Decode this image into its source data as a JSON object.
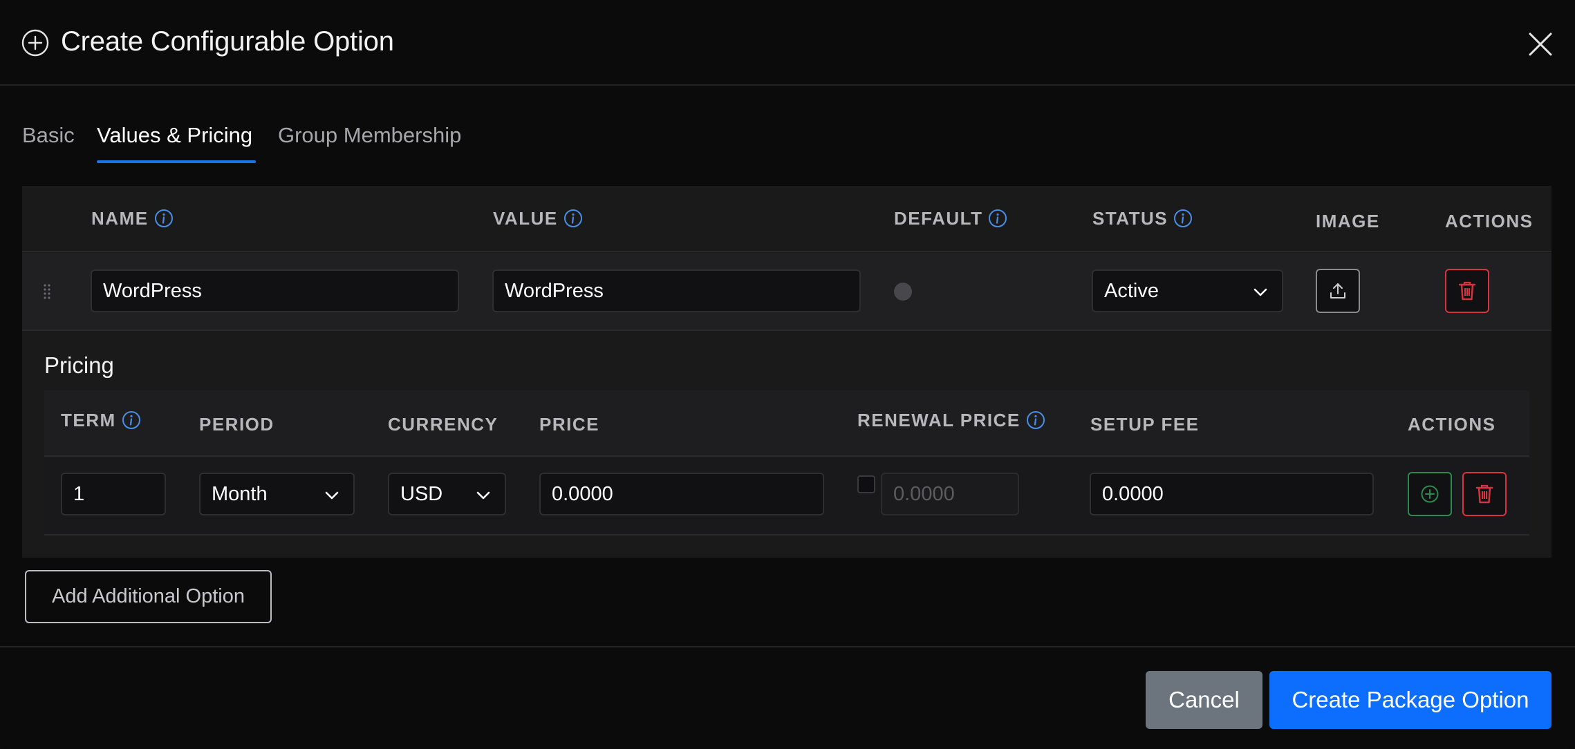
{
  "header": {
    "title": "Create Configurable Option",
    "icon": "plus-circle-icon",
    "close_icon": "close-icon"
  },
  "tabs": [
    {
      "label": "Basic",
      "active": false
    },
    {
      "label": "Values & Pricing",
      "active": true
    },
    {
      "label": "Group Membership",
      "active": false
    }
  ],
  "values_table": {
    "headers": {
      "name": "NAME",
      "value": "VALUE",
      "default": "DEFAULT",
      "status": "STATUS",
      "image": "IMAGE",
      "actions": "ACTIONS"
    },
    "row": {
      "name": "WordPress",
      "value": "WordPress",
      "default_selected": false,
      "status": "Active"
    }
  },
  "pricing": {
    "label": "Pricing",
    "headers": {
      "term": "TERM",
      "period": "PERIOD",
      "currency": "CURRENCY",
      "price": "PRICE",
      "renewal_price": "RENEWAL PRICE",
      "setup_fee": "SETUP FEE",
      "actions": "ACTIONS"
    },
    "row": {
      "term": "1",
      "period": "Month",
      "currency": "USD",
      "price": "0.0000",
      "renewal_checked": false,
      "renewal_price": "0.0000",
      "setup_fee": "0.0000"
    }
  },
  "buttons": {
    "add_option": "Add Additional Option",
    "cancel": "Cancel",
    "create": "Create Package Option"
  },
  "colors": {
    "background": "#0b0b0c",
    "accent": "#0d6efd",
    "danger": "#d8333f",
    "success": "#2c8a4e",
    "info_icon": "#4a8fe7",
    "cancel": "#6c757d"
  }
}
